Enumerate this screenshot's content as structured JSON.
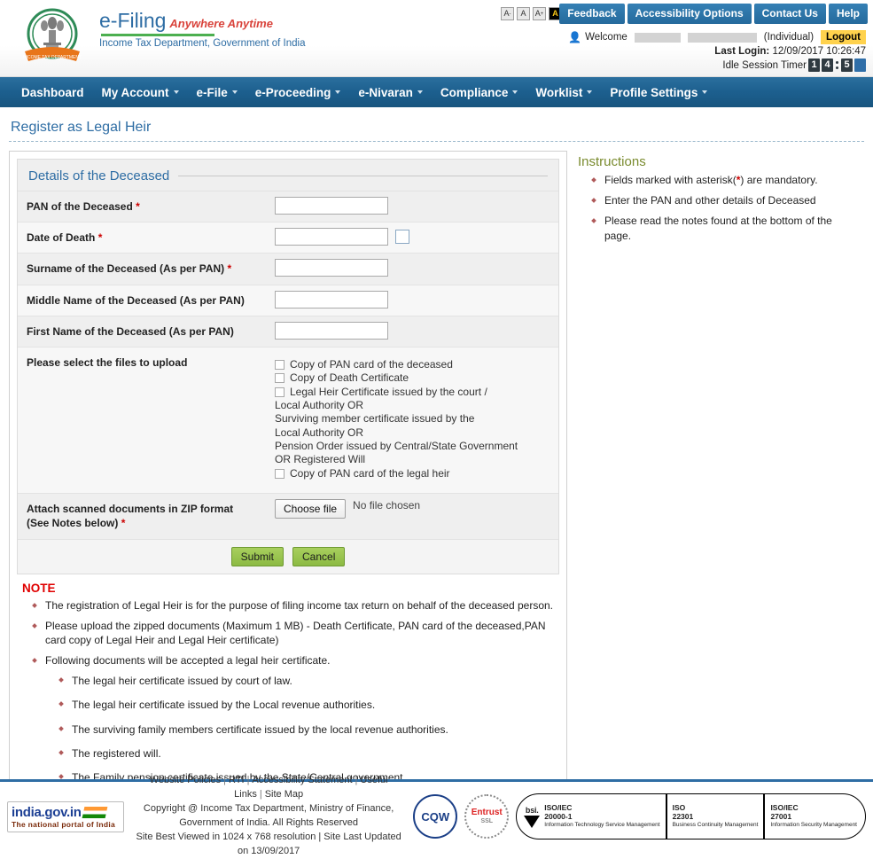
{
  "header": {
    "brand_name": "e-Filing",
    "brand_tagline": "Anywhere Anytime",
    "brand_sub": "Income Tax Department, Government of India",
    "font_controls": [
      {
        "label": "A",
        "sup": "-",
        "name": "font-decrease"
      },
      {
        "label": "A",
        "sup": "",
        "name": "font-normal"
      },
      {
        "label": "A",
        "sup": "+",
        "name": "font-increase"
      },
      {
        "label": "A",
        "sup": "",
        "name": "high-contrast"
      },
      {
        "label": "A",
        "sup": "",
        "name": "normal-contrast"
      }
    ],
    "buttons": [
      {
        "label": "Feedback"
      },
      {
        "label": "Accessibility Options"
      },
      {
        "label": "Contact Us"
      },
      {
        "label": "Help"
      }
    ],
    "welcome_label": "Welcome",
    "user_type": "(Individual)",
    "logout_label": "Logout",
    "last_login_label": "Last Login:",
    "last_login_value": "12/09/2017 10:26:47",
    "idle_label": "Idle Session Timer",
    "idle_digits": [
      "1",
      "4",
      "5"
    ]
  },
  "nav": {
    "items": [
      {
        "label": "Dashboard",
        "caret": false
      },
      {
        "label": "My Account",
        "caret": true
      },
      {
        "label": "e-File",
        "caret": true
      },
      {
        "label": "e-Proceeding",
        "caret": true
      },
      {
        "label": "e-Nivaran",
        "caret": true
      },
      {
        "label": "Compliance",
        "caret": true
      },
      {
        "label": "Worklist",
        "caret": true
      },
      {
        "label": "Profile Settings",
        "caret": true
      }
    ]
  },
  "main": {
    "page_title": "Register as Legal Heir",
    "panel_title": "Details of the Deceased",
    "fields": {
      "pan_label": "PAN of the Deceased",
      "dod_label": "Date of Death",
      "surname_label": "Surname of the Deceased (As per PAN)",
      "middle_label": "Middle Name of the Deceased (As per PAN)",
      "first_label": "First Name of the Deceased (As per PAN)",
      "upload_select_label": "Please select the files to upload",
      "attach_label_line1": "Attach scanned documents in ZIP format",
      "attach_label_line2": "(See Notes below)",
      "pan_value": "",
      "dod_value": "",
      "surname_value": "",
      "middle_value": "",
      "first_value": ""
    },
    "checkboxes": [
      {
        "label": "Copy of PAN card of the deceased",
        "checked": false
      },
      {
        "label": "Copy of Death Certificate",
        "checked": false
      },
      {
        "label": "Legal Heir Certificate issued by the court /",
        "checked": false
      },
      {
        "label": "Copy of PAN card of the legal heir",
        "checked": false
      }
    ],
    "checkbox_extra_lines": [
      "Local Authority OR",
      "Surviving member certificate issued by the",
      "Local Authority OR",
      "Pension Order issued by Central/State Government",
      "OR Registered Will"
    ],
    "file_button_label": "Choose file",
    "file_status": "No file chosen",
    "submit_label": "Submit",
    "cancel_label": "Cancel",
    "note_title": "NOTE",
    "notes": [
      "The registration of Legal Heir is for the purpose of filing income tax return on behalf of the deceased person.",
      "Please upload the zipped documents (Maximum 1 MB) - Death Certificate, PAN card of the deceased,PAN card copy of Legal Heir and Legal Heir certificate)",
      "Following documents will be accepted a legal heir certificate."
    ],
    "note_subitems": [
      "The legal heir certificate issued by court of law.",
      "The legal heir certificate issued by the Local revenue authorities.",
      "The surviving family members certificate issued by the local revenue authorities.",
      "The registered will.",
      "The Family pension certificate issued by the State/Central government."
    ]
  },
  "instructions": {
    "title": "Instructions",
    "items_pre": [
      "Fields marked with asterisk(",
      "Enter the PAN and other details of Deceased",
      "Please read the notes found at the bottom of the page."
    ],
    "item1_a": "Fields marked with asterisk(",
    "item1_star": "*",
    "item1_b": ") are mandatory.",
    "item2": "Enter the PAN and other details of Deceased",
    "item3": "Please read the notes found at the bottom of the page."
  },
  "footer": {
    "gov_logo_text": "india.gov.in",
    "gov_logo_sub": "The national portal of India",
    "links": [
      "Website Policies",
      "RTI",
      "Accessibility Statement",
      "Useful Links",
      "Site Map"
    ],
    "copyright_line1": "Copyright @ Income Tax Department, Ministry of Finance,",
    "copyright_line2": "Government of India. All Rights Reserved",
    "resolution_line": "Site Best Viewed in 1024 x 768 resolution | Site Last Updated on 13/09/2017",
    "seal_cqw": "CQW",
    "seal_entrust": "Entrust",
    "seal_entrust_sub": "SSL",
    "bsi_label": "bsi.",
    "iso_segments": [
      {
        "code": "ISO/IEC",
        "num": "20000-1",
        "desc": "Information Technology Service Management"
      },
      {
        "code": "ISO",
        "num": "22301",
        "desc": "Business Continuity Management"
      },
      {
        "code": "ISO/IEC",
        "num": "27001",
        "desc": "Information Security Management"
      }
    ]
  },
  "colors": {
    "nav_blue": "#1c5f8e",
    "title_blue": "#2e6da4",
    "required_red": "#c00000",
    "note_red": "#e00000",
    "instr_olive": "#7a8b2e",
    "submit_green": "#8cba43",
    "logout_yellow": "#ffd24d"
  }
}
